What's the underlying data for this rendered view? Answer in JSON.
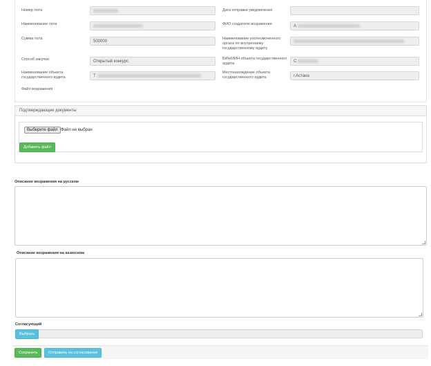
{
  "lot_info": {
    "lot_number_label": "Номер лота",
    "notice_date_label": "Дата отправки уведомления",
    "lot_name_label": "Наименование лота",
    "creator_label": "ФИО создателя возражения",
    "creator_value": "А",
    "lot_sum_label": "Сумма лота",
    "lot_sum_value": "500000",
    "authorized_body_label": "Наименование уполномоченного органа по внутреннему государственному аудиту",
    "procurement_method_label": "Способ закупки",
    "procurement_method_value": "Открытый конкурс",
    "bin_label": "БИН/ИИН объекта государственного аудита",
    "bin_value": "С",
    "audit_object_label": "Наименование объекта государственного аудита",
    "audit_object_value": "Т",
    "location_label": "Местонахождение объекта государственного аудита",
    "location_value": "г.Астана",
    "objection_file_label": "Файл возражения"
  },
  "docs": {
    "title": "Подтверждающие документы",
    "choose_file_button": "Выберите файл",
    "no_file_text": "Файл не выбран",
    "add_file_button": "Добавить файл"
  },
  "description_ru": {
    "label": "Описание возражения на русском",
    "value": ""
  },
  "description_kz": {
    "label": "Описание возражения на казахском",
    "value": ""
  },
  "approver": {
    "label": "Согласующий",
    "select_button": "Выбрать"
  },
  "footer": {
    "save_button": "Сохранить",
    "send_button": "Отправить на согласование"
  },
  "colors": {
    "green": "#5cb85c",
    "blue": "#5bc0de",
    "field_bg": "#eeeeee"
  }
}
